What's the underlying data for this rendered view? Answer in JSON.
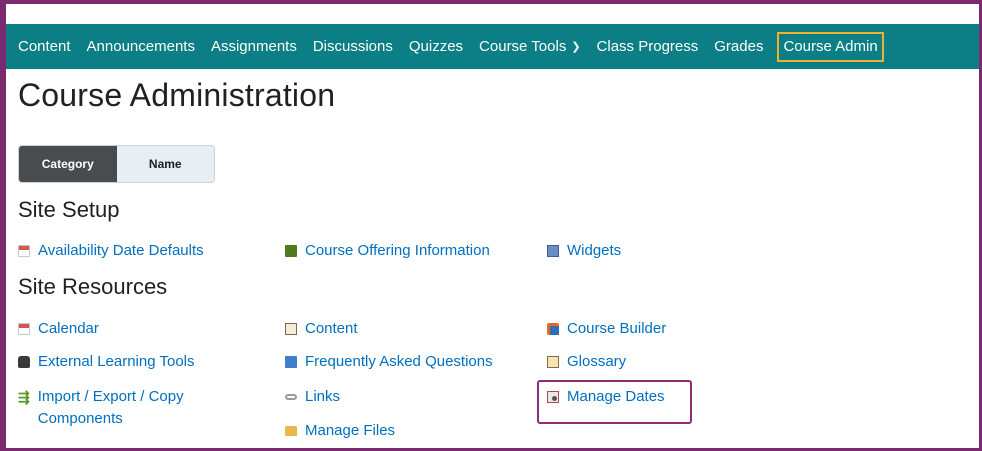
{
  "nav": {
    "items": [
      {
        "label": "Content"
      },
      {
        "label": "Announcements"
      },
      {
        "label": "Assignments"
      },
      {
        "label": "Discussions"
      },
      {
        "label": "Quizzes"
      },
      {
        "label": "Course Tools"
      },
      {
        "label": "Class Progress"
      },
      {
        "label": "Grades"
      },
      {
        "label": "Course Admin",
        "highlighted": true
      }
    ]
  },
  "page": {
    "title": "Course Administration"
  },
  "view_toggle": {
    "category": "Category",
    "name": "Name",
    "selected": "Category"
  },
  "sections": {
    "site_setup": {
      "title": "Site Setup",
      "tools": {
        "availability": "Availability Date Defaults",
        "offering": "Course Offering Information",
        "widgets": "Widgets"
      }
    },
    "site_resources": {
      "title": "Site Resources",
      "tools": {
        "calendar": "Calendar",
        "content": "Content",
        "course_builder": "Course Builder",
        "external": "External Learning Tools",
        "faq": "Frequently Asked Questions",
        "glossary": "Glossary",
        "import": "Import / Export / Copy Components",
        "links": "Links",
        "manage_dates": "Manage Dates",
        "manage_files": "Manage Files"
      }
    }
  },
  "colors": {
    "nav_bg": "#0b7e86",
    "link": "#006fbf",
    "nav_highlight": "#f0b22e",
    "callout": "#8e2e78"
  },
  "icons": {
    "course_tools_dropdown": "chevron-down-icon",
    "calendar": "calendar-icon",
    "book": "book-icon",
    "widget": "widget-icon",
    "builder": "course-builder-icon",
    "external": "external-tools-icon",
    "faq": "faq-icon",
    "glossary": "glossary-icon",
    "import": "import-export-icon",
    "links": "link-icon",
    "manage_dates": "manage-dates-icon",
    "folder": "folder-icon"
  }
}
